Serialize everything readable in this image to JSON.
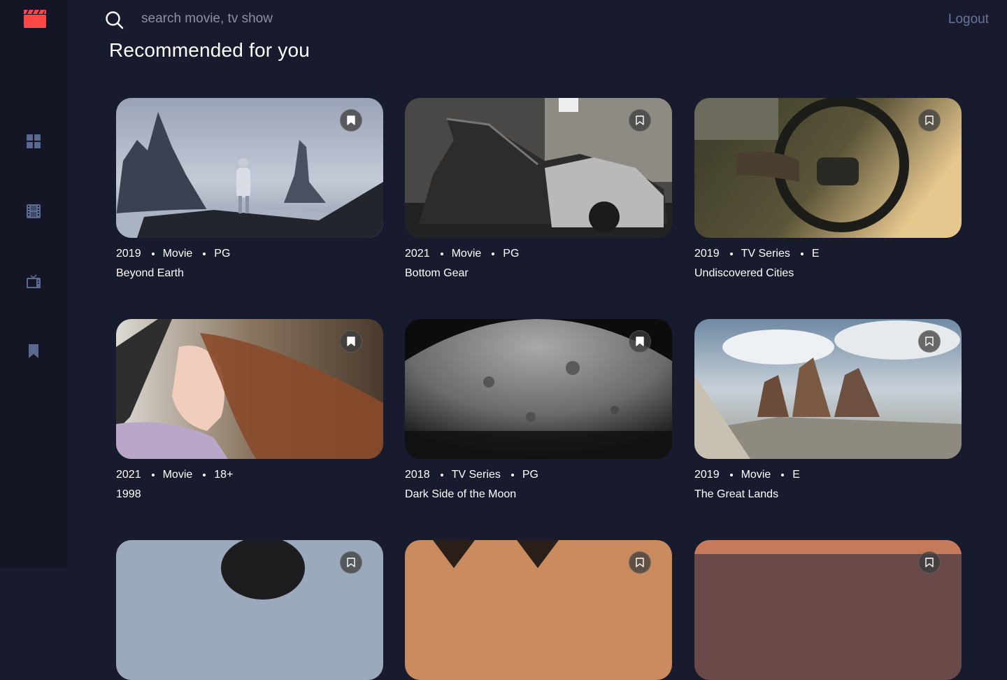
{
  "app": {
    "logo_icon": "clapperboard-icon",
    "accent_color": "#fc4747"
  },
  "sidebar": {
    "items": [
      {
        "name": "home",
        "icon": "grid-icon"
      },
      {
        "name": "movies",
        "icon": "film-icon"
      },
      {
        "name": "tv-series",
        "icon": "tv-icon"
      },
      {
        "name": "bookmarks",
        "icon": "bookmark-icon"
      }
    ]
  },
  "header": {
    "search_placeholder": "search movie, tv show",
    "logout_label": "Logout"
  },
  "main": {
    "title": "Recommended for you",
    "cards": [
      {
        "year": "2019",
        "category": "Movie",
        "rating": "PG",
        "title": "Beyond Earth",
        "bookmarked": true
      },
      {
        "year": "2021",
        "category": "Movie",
        "rating": "PG",
        "title": "Bottom Gear",
        "bookmarked": false
      },
      {
        "year": "2019",
        "category": "TV Series",
        "rating": "E",
        "title": "Undiscovered Cities",
        "bookmarked": false
      },
      {
        "year": "2021",
        "category": "Movie",
        "rating": "18+",
        "title": "1998",
        "bookmarked": true
      },
      {
        "year": "2018",
        "category": "TV Series",
        "rating": "PG",
        "title": "Dark Side of the Moon",
        "bookmarked": true
      },
      {
        "year": "2019",
        "category": "Movie",
        "rating": "E",
        "title": "The Great Lands",
        "bookmarked": false
      },
      {
        "bookmarked": false
      },
      {
        "bookmarked": false
      },
      {
        "bookmarked": false
      }
    ]
  }
}
